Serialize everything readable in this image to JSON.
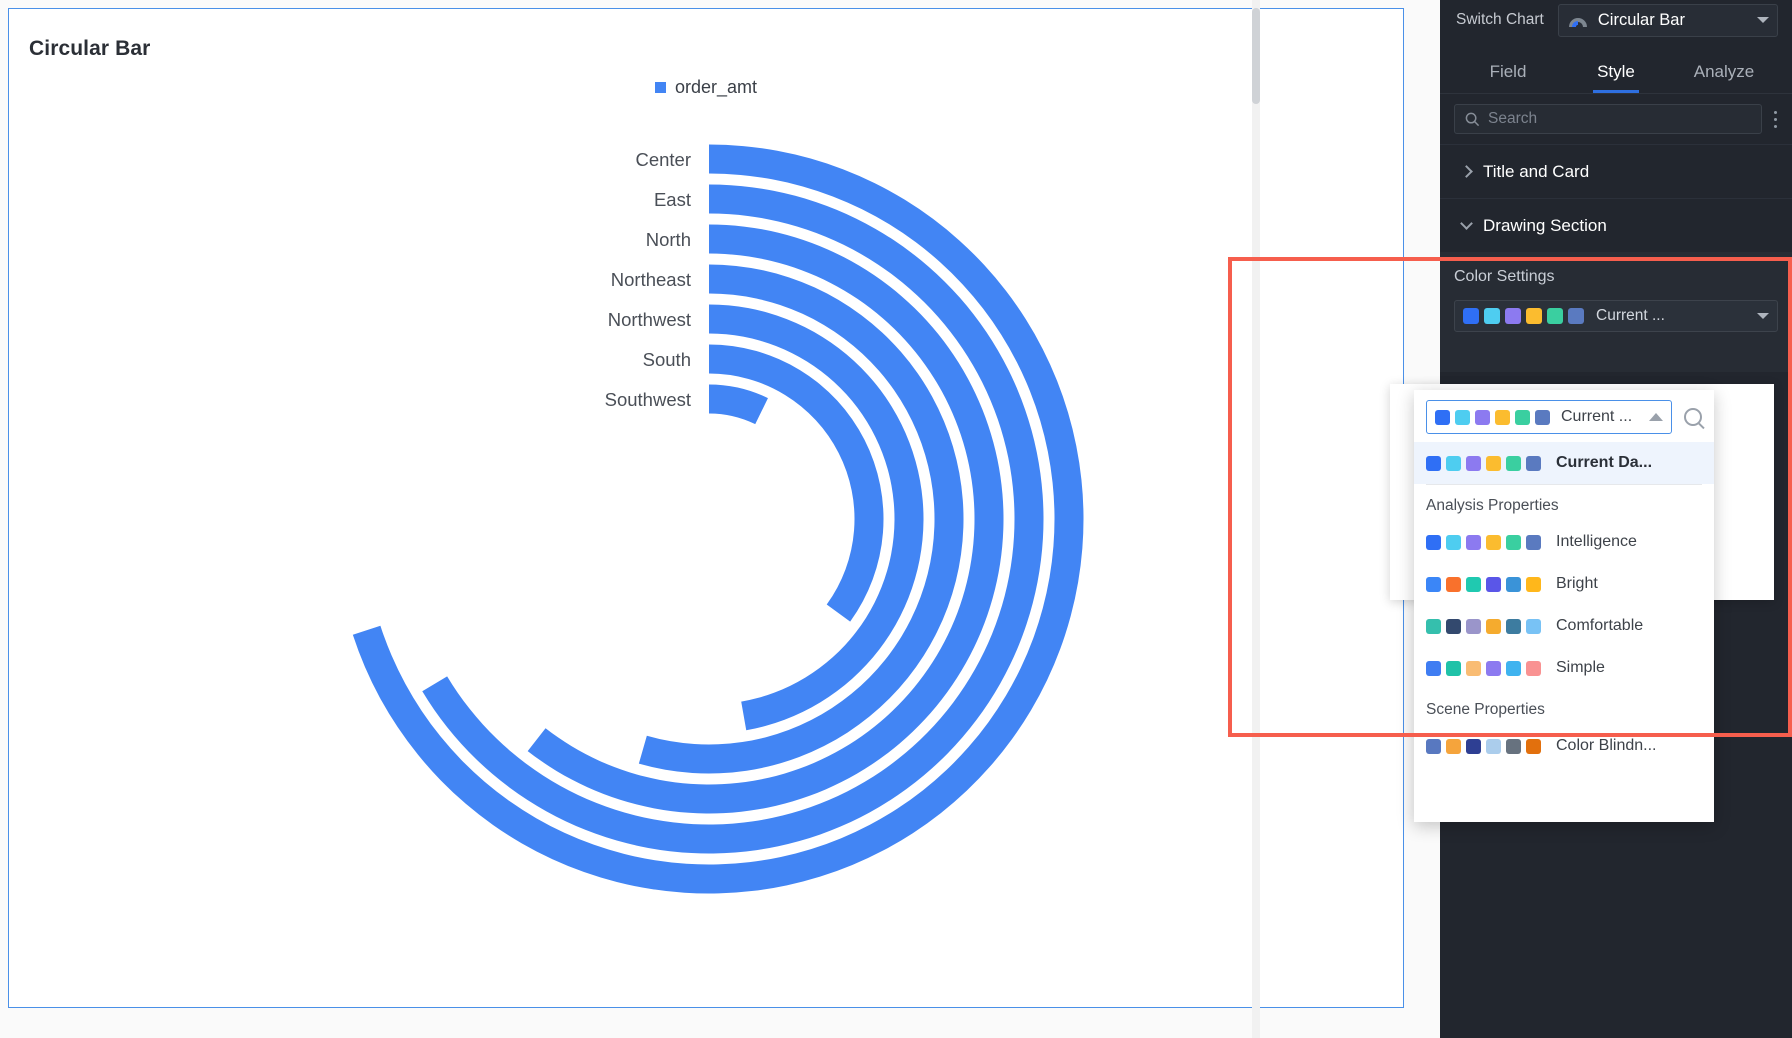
{
  "chart_card": {
    "title": "Circular Bar",
    "legend": [
      {
        "label": "order_amt",
        "color": "#4285f4"
      }
    ]
  },
  "chart_data": {
    "type": "bar",
    "chart_variant": "circular-bar",
    "title": "Circular Bar",
    "xlabel": "",
    "ylabel": "",
    "legend_position": "top-center",
    "grid": false,
    "categories": [
      "Center",
      "East",
      "North",
      "Northeast",
      "Northwest",
      "South",
      "Southwest"
    ],
    "series": [
      {
        "name": "order_amt",
        "color": "#4285f4",
        "values": [
          100,
          93,
          85,
          76,
          66,
          49,
          10
        ],
        "sweep_degrees": [
          252,
          239,
          218,
          196,
          170,
          126,
          26
        ]
      }
    ],
    "value_unit": "relative (% of max sweep)",
    "note": "Each category is drawn as a concentric ring starting at 12 o'clock and sweeping clockwise; ring radius decreases inward from Center (outermost) to Southwest (innermost)."
  },
  "panel": {
    "switch_chart_label": "Switch Chart",
    "chart_type": "Circular Bar",
    "chart_type_icon": "circular-bar-icon",
    "tabs": [
      {
        "label": "Field",
        "active": false
      },
      {
        "label": "Style",
        "active": true
      },
      {
        "label": "Analyze",
        "active": false
      }
    ],
    "search_placeholder": "Search",
    "search_value": "",
    "more_menu_icon": "dots-vertical-icon",
    "sections": [
      {
        "label": "Title and Card",
        "expanded": false,
        "icon": "chevron-right-icon"
      },
      {
        "label": "Drawing Section",
        "expanded": true,
        "icon": "chevron-down-icon"
      }
    ],
    "color_settings": {
      "title": "Color Settings",
      "selected_palette": "Current ...",
      "selected_palette_colors": [
        "#2f6ff5",
        "#4ecdf0",
        "#8c7af0",
        "#fbbc2f",
        "#3acfa0",
        "#5a7ac0"
      ]
    }
  },
  "palette_popup": {
    "selected_label": "Current ...",
    "selected_colors": [
      "#2f6ff5",
      "#4ecdf0",
      "#8c7af0",
      "#fbbc2f",
      "#3acfa0",
      "#5a7ac0"
    ],
    "search_icon": "search-icon",
    "collapse_icon": "chevron-up-icon",
    "current_item": {
      "label": "Current Da...",
      "colors": [
        "#2f6ff5",
        "#4ecdf0",
        "#8c7af0",
        "#fbbc2f",
        "#3acfa0",
        "#5a7ac0"
      ],
      "selected": true
    },
    "groups": [
      {
        "title": "Analysis Properties",
        "items": [
          {
            "label": "Intelligence",
            "colors": [
              "#2f6ff5",
              "#4ecdf0",
              "#8c7af0",
              "#fbbc2f",
              "#3acfa0",
              "#5a7ac0"
            ]
          },
          {
            "label": "Bright",
            "colors": [
              "#3b86f7",
              "#f9712c",
              "#20c9b0",
              "#5a56e8",
              "#3a93d8",
              "#ffb71b"
            ]
          },
          {
            "label": "Comfortable",
            "colors": [
              "#35bfad",
              "#33496e",
              "#9a95ca",
              "#f5ab2e",
              "#3d7ca0",
              "#78c2f5"
            ]
          },
          {
            "label": "Simple",
            "colors": [
              "#3f7df2",
              "#20c2a8",
              "#f9bc73",
              "#8c7af0",
              "#3fb3ef",
              "#f99292"
            ]
          }
        ]
      },
      {
        "title": "Scene Properties",
        "items": [
          {
            "label": "Color Blindn...",
            "colors": [
              "#5878c0",
              "#f5a43c",
              "#2e3f93",
              "#abcdec",
              "#67727f",
              "#e2700d"
            ]
          }
        ]
      }
    ]
  },
  "highlight": {
    "color": "#f65e4d",
    "name": "color-settings-highlight"
  }
}
